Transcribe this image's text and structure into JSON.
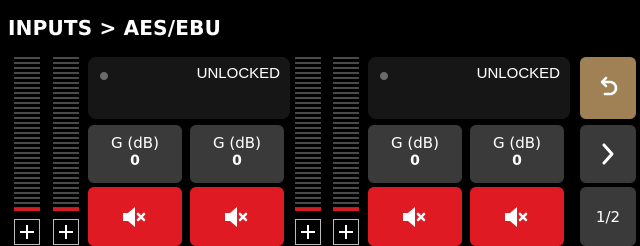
{
  "header": {
    "title": "INPUTS > AES/EBU"
  },
  "groups": [
    {
      "status": "UNLOCKED",
      "channels": [
        {
          "gain_label": "G (dB)",
          "gain_value": "0",
          "muted": true
        },
        {
          "gain_label": "G (dB)",
          "gain_value": "0",
          "muted": true
        }
      ]
    },
    {
      "status": "UNLOCKED",
      "channels": [
        {
          "gain_label": "G (dB)",
          "gain_value": "0",
          "muted": true
        },
        {
          "gain_label": "G (dB)",
          "gain_value": "0",
          "muted": true
        }
      ]
    }
  ],
  "nav": {
    "page_label": "1/2",
    "back_icon": "undo-arrow-icon",
    "next_icon": "chevron-right-icon"
  },
  "colors": {
    "mute_active": "#e01a22",
    "back_button": "#a08055",
    "button": "#3a3a3a",
    "panel": "#161616",
    "meter_peak": "#d21c24"
  }
}
